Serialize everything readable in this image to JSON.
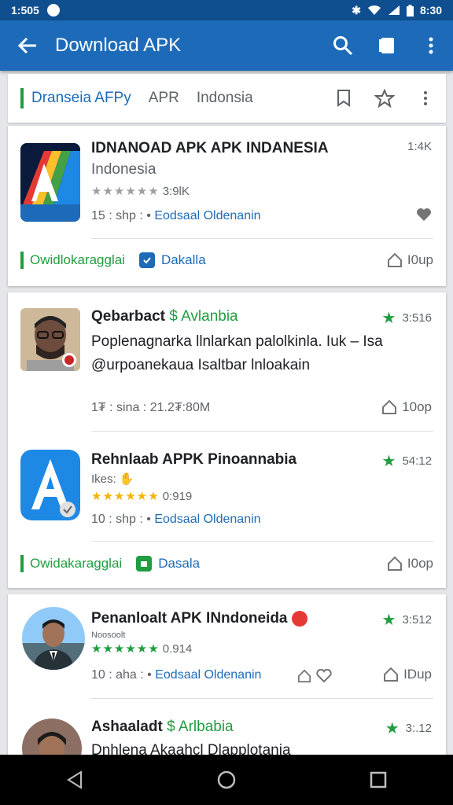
{
  "status": {
    "time": "1:505",
    "clock": "8:30"
  },
  "appbar": {
    "title": "Download APK",
    "icons": [
      "back-arrow-icon",
      "search-icon",
      "bookmark-icon",
      "more-vert-icon"
    ]
  },
  "filter": {
    "chip1": "Dranseia AFPy",
    "chip2": "APR",
    "chip3": "Indonsia"
  },
  "item1": {
    "title": "IDNANOAD APK APK INDANESIA",
    "subtitle": "Indonesia",
    "rating": "3:9lK",
    "meta_prefix": "15 : shp : •",
    "meta_link": "Eodsaal Oldenanin",
    "size": "1:4K",
    "category": "Owidlokaragglai",
    "detail": "Dakalla",
    "install": "I0up"
  },
  "item2": {
    "title": "Qebarbact",
    "title_tag": "Avlanbia",
    "body": "Poplenagnarka llnlarkan palolkinla. Iuk – Isa @urpoanekaua Isaltbar lnloakain",
    "meta": "1₮ : sina : 21.2₮:80M",
    "size": "3:516",
    "install": "10op"
  },
  "item3": {
    "title": "Rehnlaab APPK Pinoannabia",
    "subtitle": "Ikes:",
    "rating": "0:919",
    "meta_prefix": "10 : shp : •",
    "meta_link": "Eodsaal Oldenanin",
    "size": "54:12",
    "category": "Owidakaragglai",
    "detail": "Dasala",
    "install": "I0op"
  },
  "item4": {
    "title": "Penanloalt APK INndoneida",
    "subtitle": "Noosoolt",
    "rating": "0.914",
    "meta_prefix": "10 : aha : •",
    "meta_link": "Eodsaal Oldenanin",
    "size": "3:512",
    "install": "IDup"
  },
  "item5": {
    "title": "Ashaaladt",
    "title_tag": "Arlbabia",
    "body": "Dnhlena Akaahcl Dlapplotania",
    "size": "3:.12"
  },
  "colors": {
    "appbar": "#1d6bb8",
    "status": "#0f4f8f",
    "accent_green": "#1f9d3f",
    "link_blue": "#1d6bb8",
    "star_gold": "#f5b400"
  }
}
